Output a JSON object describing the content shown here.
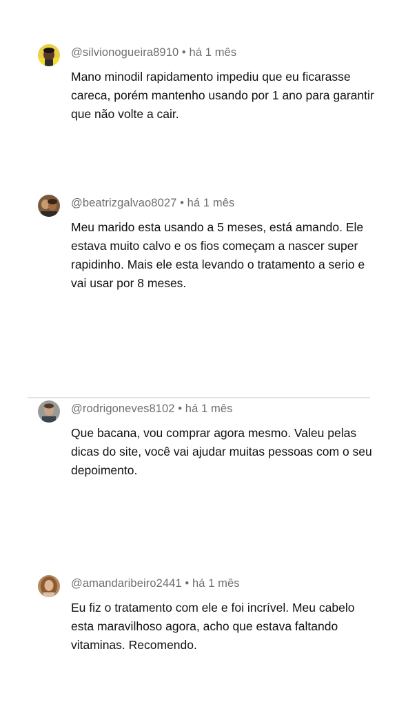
{
  "comments": [
    {
      "handle": "@silvionogueira8910",
      "separator": " • ",
      "time": "há 1 mês",
      "text": "Mano minodil rapidamento impediu que eu ficarasse careca, porém mantenho usando por 1 ano para garantir que não volte a cair."
    },
    {
      "handle": "@beatrizgalvao8027",
      "separator": " • ",
      "time": "há 1 mês",
      "text": "Meu marido esta usando a 5 meses, está amando. Ele estava muito calvo e os fios começam a nascer super rapidinho. Mais ele esta levando o tratamento a serio e vai usar por 8 meses."
    },
    {
      "handle": "@rodrigoneves8102",
      "separator": " • ",
      "time": "há 1 mês",
      "text": "Que bacana, vou comprar agora mesmo. Valeu pelas dicas do site, você vai ajudar muitas pessoas com o seu depoimento."
    },
    {
      "handle": "@amandaribeiro2441",
      "separator": " • ",
      "time": "há 1 mês",
      "text": "Eu fiz o tratamento com ele e foi incrível. Meu cabelo esta maravilhoso agora, acho que estava faltando vitaminas. Recomendo."
    }
  ],
  "colors": {
    "meta": "#6e6e6e",
    "text": "#111111",
    "divider": "#e3e3e3"
  }
}
